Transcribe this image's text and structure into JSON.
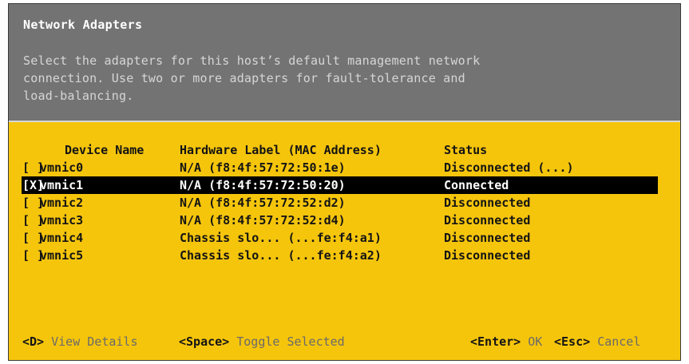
{
  "dialog": {
    "title": "Network Adapters",
    "description": "Select the adapters for this host’s default management network\nconnection. Use two or more adapters for fault-tolerance and\nload-balancing."
  },
  "table": {
    "columns": {
      "device": "Device Name",
      "hardware": "Hardware Label (MAC Address)",
      "status": "Status"
    },
    "rows": [
      {
        "check": "[ ]",
        "device": "vmnic0",
        "hardware": "N/A (f8:4f:57:72:50:1e)",
        "status": "Disconnected (...)",
        "selected": false
      },
      {
        "check": "[X]",
        "device": "vmnic1",
        "hardware": "N/A (f8:4f:57:72:50:20)",
        "status": "Connected",
        "selected": true
      },
      {
        "check": "[ ]",
        "device": "vmnic2",
        "hardware": "N/A (f8:4f:57:72:52:d2)",
        "status": "Disconnected",
        "selected": false
      },
      {
        "check": "[ ]",
        "device": "vmnic3",
        "hardware": "N/A (f8:4f:57:72:52:d4)",
        "status": "Disconnected",
        "selected": false
      },
      {
        "check": "[ ]",
        "device": "vmnic4",
        "hardware": "Chassis slo... (...fe:f4:a1)",
        "status": "Disconnected",
        "selected": false
      },
      {
        "check": "[ ]",
        "device": "vmnic5",
        "hardware": "Chassis slo... (...fe:f4:a2)",
        "status": "Disconnected",
        "selected": false
      }
    ]
  },
  "footer": [
    {
      "key": "<D>",
      "action": "View Details"
    },
    {
      "key": "<Space>",
      "action": "Toggle Selected"
    },
    {
      "key": "<Enter>",
      "action": "OK"
    },
    {
      "key": "<Esc>",
      "action": "Cancel"
    }
  ],
  "colors": {
    "header_bg": "#737373",
    "body_bg": "#f5c50c",
    "selection_bg": "#000000"
  }
}
